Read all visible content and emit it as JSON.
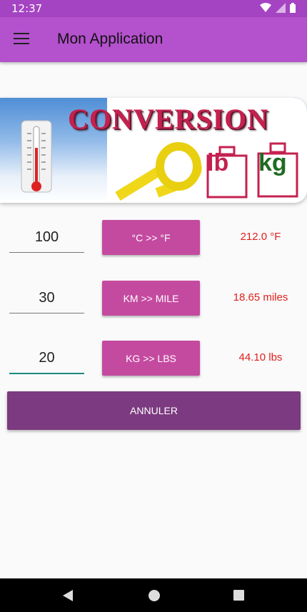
{
  "status_bar": {
    "time": "12:37"
  },
  "app_bar": {
    "title": "Mon Application",
    "menu_icon": "menu-icon"
  },
  "banner": {
    "title": "CONVERSION",
    "unit_lb": "lb",
    "unit_kg": "kg"
  },
  "rows": [
    {
      "input_value": "100",
      "button_label": "°C >> °F",
      "result": "212.0 °F"
    },
    {
      "input_value": "30",
      "button_label": "KM >> MILE",
      "result": "18.65 miles"
    },
    {
      "input_value": "20",
      "button_label": "KG >> LBS",
      "result": "44.10 lbs"
    }
  ],
  "cancel_button": "ANNULER",
  "colors": {
    "status_bar": "#a544c2",
    "app_bar": "#b451cd",
    "convert_button": "#c44aa0",
    "cancel_button": "#7c3a80",
    "result_text": "#e0211e",
    "focus_underline": "#1b8a83"
  }
}
